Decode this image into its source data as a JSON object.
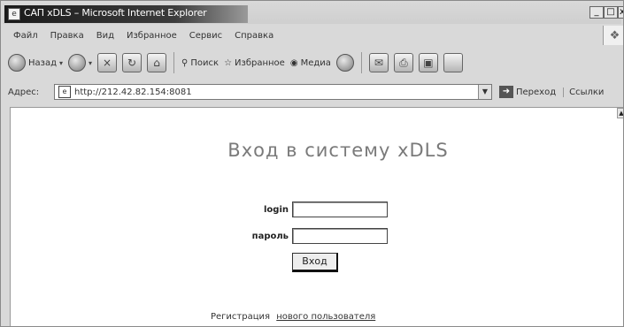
{
  "window": {
    "title": "САП xDLS – Microsoft Internet Explorer",
    "controls": [
      "_",
      "□",
      "x"
    ]
  },
  "menu": [
    "Файл",
    "Правка",
    "Вид",
    "Избранное",
    "Сервис",
    "Справка"
  ],
  "toolbar": {
    "back_label": "Назад",
    "search_label": "Поиск",
    "favorites_label": "Избранное",
    "media_label": "Медиа"
  },
  "address": {
    "label": "Адрес:",
    "url": "http://212.42.82.154:8081",
    "go_label": "Переход",
    "links_label": "Ссылки"
  },
  "page": {
    "heading": "Вход в систему xDLS",
    "login_label": "login",
    "password_label": "пароль",
    "submit_label": "Вход",
    "register_prefix": "Регистрация",
    "register_link": "нового пользователя"
  }
}
